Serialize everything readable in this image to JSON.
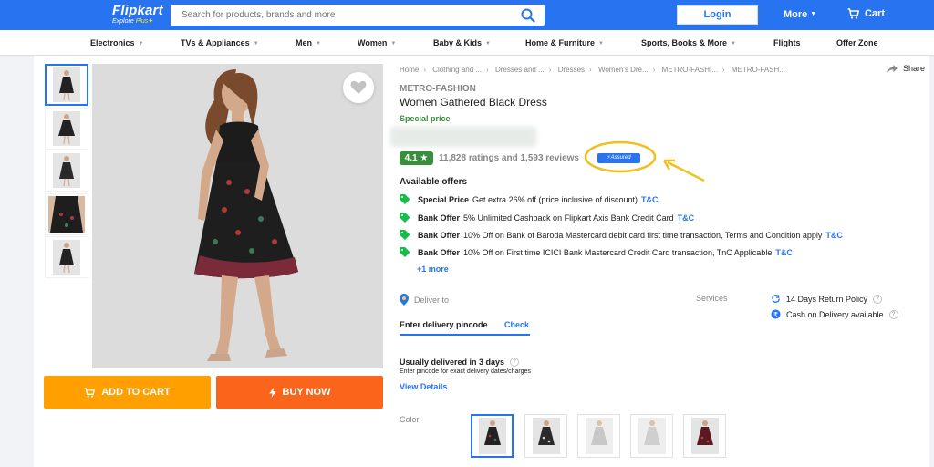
{
  "header": {
    "logo_name": "Flipkart",
    "logo_sub_prefix": "Explore",
    "logo_sub_plus": "Plus",
    "search_placeholder": "Search for products, brands and more",
    "login_label": "Login",
    "more_label": "More",
    "cart_label": "Cart",
    "brand_color": "#2874f0"
  },
  "categories": [
    {
      "label": "Electronics",
      "dropdown": true
    },
    {
      "label": "TVs & Appliances",
      "dropdown": true
    },
    {
      "label": "Men",
      "dropdown": true
    },
    {
      "label": "Women",
      "dropdown": true
    },
    {
      "label": "Baby & Kids",
      "dropdown": true
    },
    {
      "label": "Home & Furniture",
      "dropdown": true
    },
    {
      "label": "Sports, Books & More",
      "dropdown": true
    },
    {
      "label": "Flights",
      "dropdown": false
    },
    {
      "label": "Offer Zone",
      "dropdown": false
    }
  ],
  "gallery": {
    "thumbnail_count": 5,
    "active_thumbnail": 1,
    "wishlist_icon": "heart-icon"
  },
  "actions": {
    "add_to_cart": "ADD TO CART",
    "buy_now": "BUY NOW",
    "add_to_cart_color": "#ff9f00",
    "buy_now_color": "#fb641b"
  },
  "breadcrumbs": [
    "Home",
    "Clothing and ...",
    "Dresses and ...",
    "Dresses",
    "Women's Dre...",
    "METRO-FASHI...",
    "METRO-FASH..."
  ],
  "share_label": "Share",
  "product": {
    "brand": "METRO-FASHION",
    "title": "Women Gathered Black Dress",
    "special_price_label": "Special price",
    "rating": "4.1",
    "rating_star": "★",
    "ratings_reviews": "11,828 ratings and 1,593 reviews",
    "assured_label": "Assured"
  },
  "offers": {
    "title": "Available offers",
    "items": [
      {
        "type": "Special Price",
        "text": "Get extra 26% off (price inclusive of discount)",
        "link": "T&C"
      },
      {
        "type": "Bank Offer",
        "text": "5% Unlimited Cashback on Flipkart Axis Bank Credit Card",
        "link": "T&C"
      },
      {
        "type": "Bank Offer",
        "text": "10% Off on Bank of Baroda Mastercard debit card first time transaction, Terms and Condition apply",
        "link": "T&C"
      },
      {
        "type": "Bank Offer",
        "text": "10% Off on First time ICICI Bank Mastercard Credit Card transaction, TnC Applicable",
        "link": "T&C"
      }
    ],
    "more_link": "+1 more"
  },
  "delivery": {
    "label": "Deliver to",
    "pincode_placeholder": "Enter delivery pincode",
    "check_label": "Check",
    "usual_text": "Usually delivered in 3 days",
    "note": "Enter pincode for exact delivery dates/charges",
    "view_details": "View Details"
  },
  "services": {
    "label": "Services",
    "items": [
      "14 Days Return Policy",
      "Cash on Delivery available"
    ]
  },
  "color": {
    "label": "Color",
    "swatch_count": 5,
    "active_swatch": 1
  },
  "annotation_color": "#f0c020"
}
